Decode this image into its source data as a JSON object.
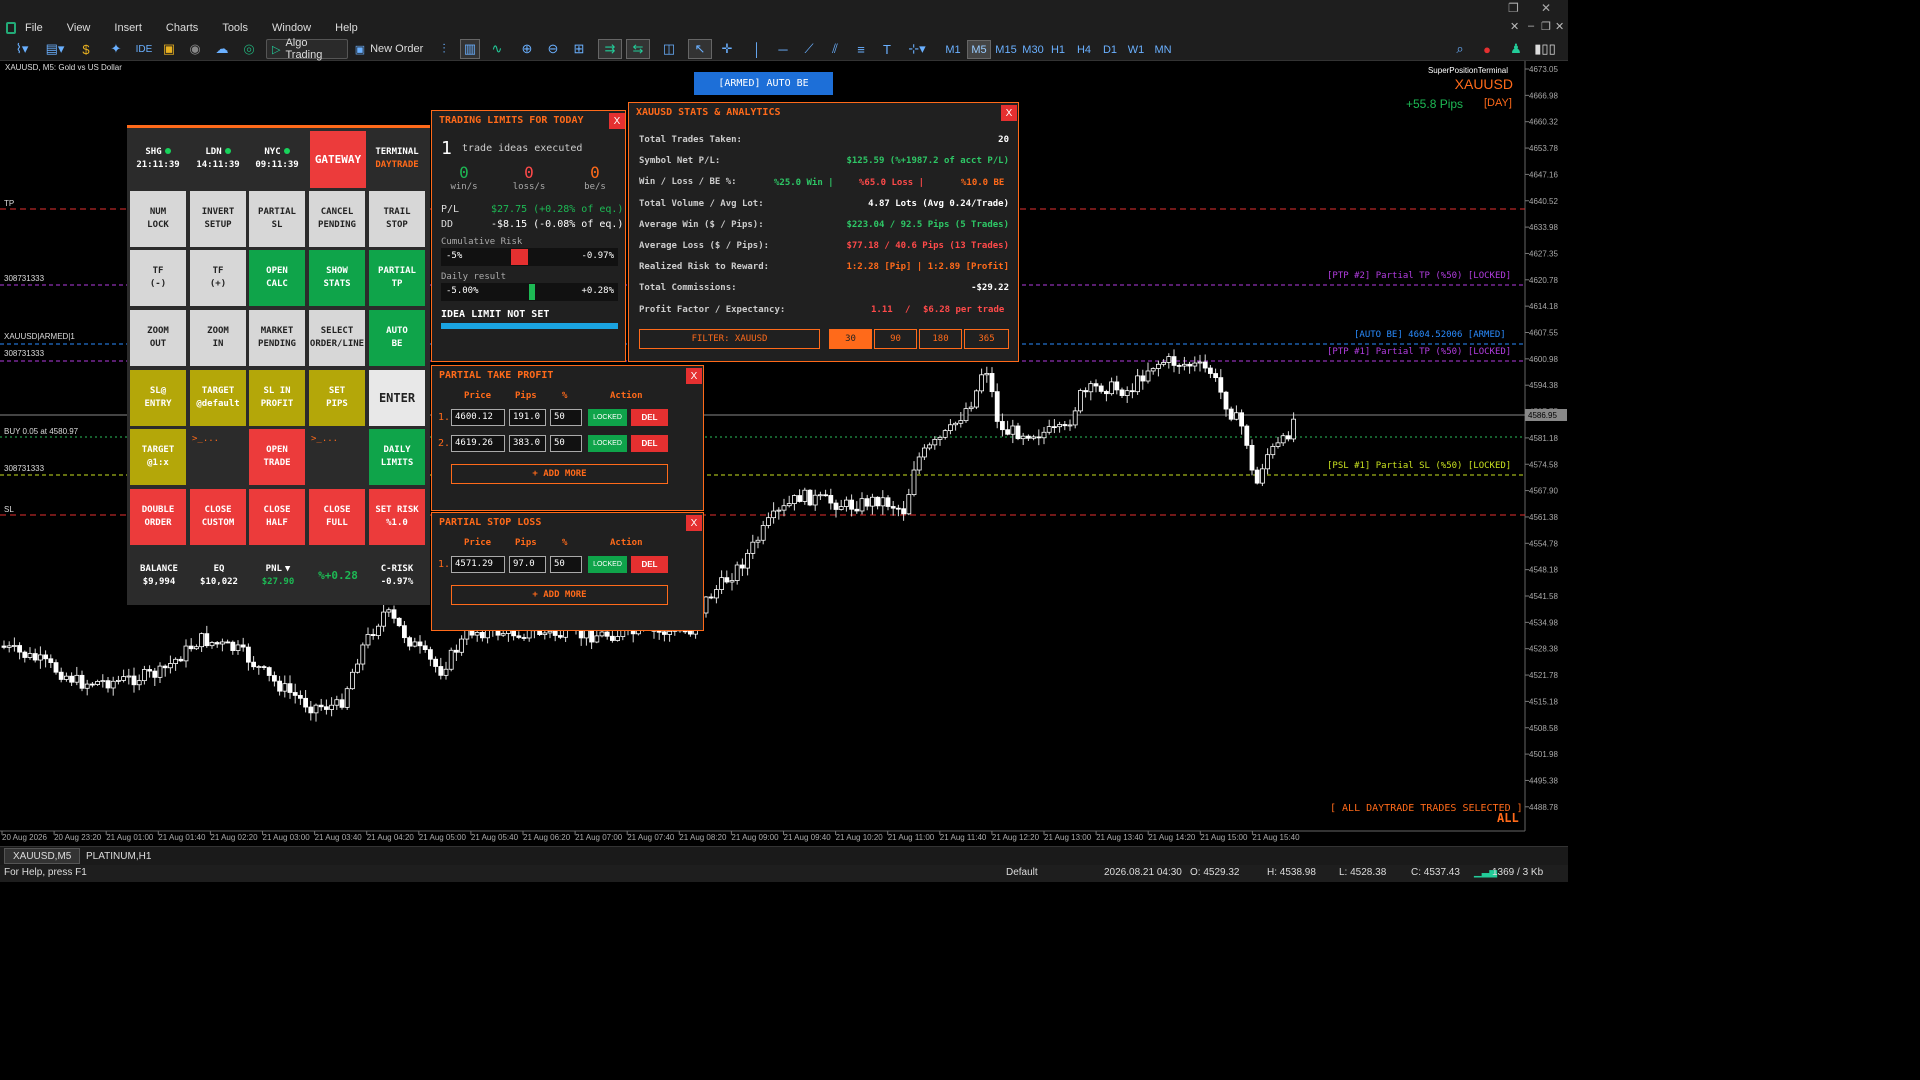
{
  "menu": [
    "File",
    "View",
    "Insert",
    "Charts",
    "Tools",
    "Window",
    "Help"
  ],
  "toolbar": {
    "algo_trading": "Algo Trading",
    "new_order": "New Order",
    "ide": "IDE",
    "timeframes": [
      "M1",
      "M5",
      "M15",
      "M30",
      "H1",
      "H4",
      "D1",
      "W1",
      "MN"
    ],
    "selected_timeframe": "M5"
  },
  "chart": {
    "caption": "XAUUSD, M5:  Gold vs US Dollar",
    "terminal_name": "SuperPositionTerminal",
    "symbol": "XAUUSD",
    "pips_gain": "+55.8 Pips",
    "pips_period": "[DAY]",
    "armed_button": "[ARMED] AUTO BE",
    "current_price_tag": "4586.95",
    "line_labels": {
      "ptp2": "[PTP #2] Partial TP (%50) [LOCKED]",
      "autobe": "[AUTO BE] 4604.52006  [ARMED]",
      "ptp1": "[PTP #1] Partial TP (%50) [LOCKED]",
      "psl1": "[PSL #1] Partial SL (%50) [LOCKED]"
    },
    "left_labels": {
      "tp": "TP",
      "id1": "308731333",
      "armed": "XAUUSD|ARMED|1",
      "id2": "308731333",
      "buy": "BUY 0.05 at 4580.97",
      "id3": "308731333",
      "sl": "SL"
    },
    "all_trades_text": "[ ALL DAYTRADE TRADES SELECTED ]",
    "all_word": "ALL",
    "price_axis": [
      "4673.05",
      "4666.98",
      "4660.32",
      "4653.78",
      "4647.16",
      "4640.52",
      "4633.98",
      "4627.35",
      "4620.78",
      "4614.18",
      "4607.55",
      "4600.98",
      "4594.38",
      "4587.75",
      "4581.18",
      "4574.58",
      "4567.90",
      "4561.38",
      "4554.78",
      "4548.18",
      "4541.58",
      "4534.98",
      "4528.38",
      "4521.78",
      "4515.18",
      "4508.58",
      "4501.98",
      "4495.38",
      "4488.78"
    ],
    "time_axis": [
      "20 Aug 2026",
      "20 Aug 23:20",
      "21 Aug 01:00",
      "21 Aug 01:40",
      "21 Aug 02:20",
      "21 Aug 03:00",
      "21 Aug 03:40",
      "21 Aug 04:20",
      "21 Aug 05:00",
      "21 Aug 05:40",
      "21 Aug 06:20",
      "21 Aug 07:00",
      "21 Aug 07:40",
      "21 Aug 08:20",
      "21 Aug 09:00",
      "21 Aug 09:40",
      "21 Aug 10:20",
      "21 Aug 11:00",
      "21 Aug 11:40",
      "21 Aug 12:20",
      "21 Aug 13:00",
      "21 Aug 13:40",
      "21 Aug 14:20",
      "21 Aug 15:00",
      "21 Aug 15:40"
    ]
  },
  "panel": {
    "sessions": [
      {
        "name": "SHG",
        "time": "21:11:39"
      },
      {
        "name": "LDN",
        "time": "14:11:39"
      },
      {
        "name": "NYC",
        "time": "09:11:39"
      }
    ],
    "gateway": "GATEWAY",
    "terminal": "TERMINAL",
    "terminal_mode": "DAYTRADE",
    "buttons": [
      {
        "label": "NUM\nLOCK",
        "color": "gray"
      },
      {
        "label": "INVERT\nSETUP",
        "color": "gray"
      },
      {
        "label": "PARTIAL\nSL",
        "color": "gray"
      },
      {
        "label": "CANCEL\nPENDING",
        "color": "gray"
      },
      {
        "label": "TRAIL\nSTOP",
        "color": "gray"
      },
      {
        "label": "TF\n(-)",
        "color": "gray"
      },
      {
        "label": "TF\n(+)",
        "color": "gray"
      },
      {
        "label": "OPEN\nCALC",
        "color": "green"
      },
      {
        "label": "SHOW\nSTATS",
        "color": "green"
      },
      {
        "label": "PARTIAL\nTP",
        "color": "green"
      },
      {
        "label": "ZOOM\nOUT",
        "color": "gray"
      },
      {
        "label": "ZOOM\nIN",
        "color": "gray"
      },
      {
        "label": "MARKET\nPENDING",
        "color": "gray"
      },
      {
        "label": "SELECT\nORDER/LINE",
        "color": "gray"
      },
      {
        "label": "AUTO\nBE",
        "color": "green"
      },
      {
        "label": "SL@\nENTRY",
        "color": "olive"
      },
      {
        "label": "TARGET\n@default",
        "color": "olive"
      },
      {
        "label": "SL IN\nPROFIT",
        "color": "olive"
      },
      {
        "label": "SET\nPIPS",
        "color": "olive"
      },
      {
        "label": "ENTER",
        "color": "light"
      },
      {
        "label": "TARGET\n@1:x",
        "color": "olive"
      },
      {
        "label": ">_...",
        "color": "dark"
      },
      {
        "label": "OPEN\nTRADE",
        "color": "red"
      },
      {
        "label": ">_...",
        "color": "dark"
      },
      {
        "label": "DAILY\nLIMITS",
        "color": "green"
      },
      {
        "label": "DOUBLE\nORDER",
        "color": "red"
      },
      {
        "label": "CLOSE\nCUSTOM",
        "color": "red"
      },
      {
        "label": "CLOSE\nHALF",
        "color": "red"
      },
      {
        "label": "CLOSE\nFULL",
        "color": "red"
      },
      {
        "label": "SET RISK\n%1.0",
        "color": "red"
      }
    ],
    "balance_label": "BALANCE",
    "balance": "$9,994",
    "eq_label": "EQ",
    "eq": "$10,022",
    "pnl_label": "PNL",
    "pnl": "$27.90",
    "pnl_pct": "%+0.28",
    "crisk_label": "C-RISK",
    "crisk": "-0.97%"
  },
  "limits": {
    "title": "TRADING LIMITS FOR TODAY",
    "close": "X",
    "ideas_count": "1",
    "ideas_text": "trade ideas executed",
    "wins": "0",
    "wins_label": "win/s",
    "losses": "0",
    "losses_label": "loss/s",
    "be": "0",
    "be_label": "be/s",
    "pl_label": "P/L",
    "pl_value": "$27.75 (+0.28% of eq.)",
    "dd_label": "DD",
    "dd_value": "-$8.15 (-0.08% of eq.)",
    "cum_risk_label": "Cumulative Risk",
    "cum_risk_min": "-5%",
    "cum_risk_val": "-0.97%",
    "daily_label": "Daily result",
    "daily_min": "-5.00%",
    "daily_val": "+0.28%",
    "idea_limit": "IDEA LIMIT NOT SET"
  },
  "stats": {
    "title": "XAUUSD STATS & ANALYTICS",
    "close": "X",
    "rows": [
      {
        "label": "Total Trades Taken:",
        "value": "20",
        "color": "#ffffff"
      },
      {
        "label": "Symbol Net P/L:",
        "value": "$125.59 (%+1987.2 of acct P/L)",
        "color": "#2ec766"
      },
      {
        "label": "Win / Loss / BE %:",
        "value": "",
        "color": "#ffffff"
      },
      {
        "label": "Total Volume / Avg Lot:",
        "value": "4.87 Lots (Avg 0.24/Trade)",
        "color": "#ffffff"
      },
      {
        "label": "Average Win ($ / Pips):",
        "value": "$223.04 / 92.5 Pips (5 Trades)",
        "color": "#2ec766"
      },
      {
        "label": "Average Loss ($ / Pips):",
        "value": "$77.18 / 40.6 Pips (13 Trades)",
        "color": "#ff4a4a"
      },
      {
        "label": "Realized Risk to Reward:",
        "value": "1:2.28 [Pip] | 1:2.89 [Profit]",
        "color": "#ff6a1a"
      },
      {
        "label": "Total Commissions:",
        "value": "-$29.22",
        "color": "#ffffff"
      },
      {
        "label": "Profit Factor / Expectancy:",
        "value": "",
        "color": "#ffffff"
      }
    ],
    "winrate": "%25.0 Win  |",
    "lossrate": "%65.0 Loss  |",
    "berate": "%10.0 BE",
    "profit_factor": "1.11",
    "pf_sep": "/",
    "expectancy": "$6.28 per trade",
    "filter": "FILTER: XAUUSD",
    "periods": [
      "30",
      "90",
      "180",
      "365"
    ]
  },
  "ptp": {
    "title": "PARTIAL TAKE PROFIT",
    "close": "X",
    "headers": {
      "price": "Price",
      "pips": "Pips",
      "pct": "%",
      "action": "Action"
    },
    "rows": [
      {
        "num": "1.",
        "price": "4600.12",
        "pips": "191.0",
        "pct": "50"
      },
      {
        "num": "2.",
        "price": "4619.26",
        "pips": "383.0",
        "pct": "50"
      }
    ],
    "locked": "LOCKED",
    "del": "DEL",
    "add_more": "+ ADD MORE"
  },
  "psl": {
    "title": "PARTIAL STOP LOSS",
    "close": "X",
    "headers": {
      "price": "Price",
      "pips": "Pips",
      "pct": "%",
      "action": "Action"
    },
    "rows": [
      {
        "num": "1.",
        "price": "4571.29",
        "pips": "97.0",
        "pct": "50"
      }
    ],
    "locked": "LOCKED",
    "del": "DEL",
    "add_more": "+ ADD MORE"
  },
  "tabs": [
    "XAUUSD,M5",
    "PLATINUM,H1"
  ],
  "status": {
    "help": "For Help, press F1",
    "profile": "Default",
    "datetime": "2026.08.21 04:30",
    "open": "O: 4529.32",
    "high": "H: 4538.98",
    "low": "L: 4528.38",
    "close": "C: 4537.43",
    "traffic": "1369 / 3 Kb"
  }
}
